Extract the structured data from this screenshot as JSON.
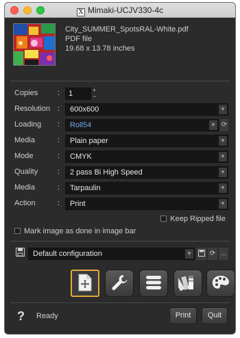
{
  "window": {
    "title": "Mimaki-UCJV330-4c",
    "title_icon": "X"
  },
  "file": {
    "name": "City_SUMMER_SpotsRAL-White.pdf",
    "type": "PDF file",
    "size": "19.68 x 13.78 inches"
  },
  "settings": {
    "copies": {
      "label": "Copies",
      "value": "1"
    },
    "resolution": {
      "label": "Resolution",
      "value": "600x600"
    },
    "loading": {
      "label": "Loading",
      "value": "Roll54"
    },
    "media1": {
      "label": "Media",
      "value": "Plain paper"
    },
    "mode": {
      "label": "Mode",
      "value": "CMYK"
    },
    "quality": {
      "label": "Quality",
      "value": "2 pass Bi High Speed"
    },
    "media2": {
      "label": "Media",
      "value": "Tarpaulin"
    },
    "action": {
      "label": "Action",
      "value": "Print"
    },
    "colon": ":"
  },
  "options": {
    "keep_ripped": "Keep Ripped file",
    "mark_image": "Mark image as done in image bar"
  },
  "config": {
    "value": "Default configuration",
    "more": "..."
  },
  "toolbar": {
    "items": [
      "layout-icon",
      "wrench-icon",
      "stack-icon",
      "swatch-icon",
      "palette-icon"
    ]
  },
  "status": {
    "help": "?",
    "text": "Ready"
  },
  "buttons": {
    "print": "Print",
    "quit": "Quit"
  },
  "colors": {
    "active_tool_border": "#e8a93a",
    "roll_text": "#73a9e6"
  }
}
